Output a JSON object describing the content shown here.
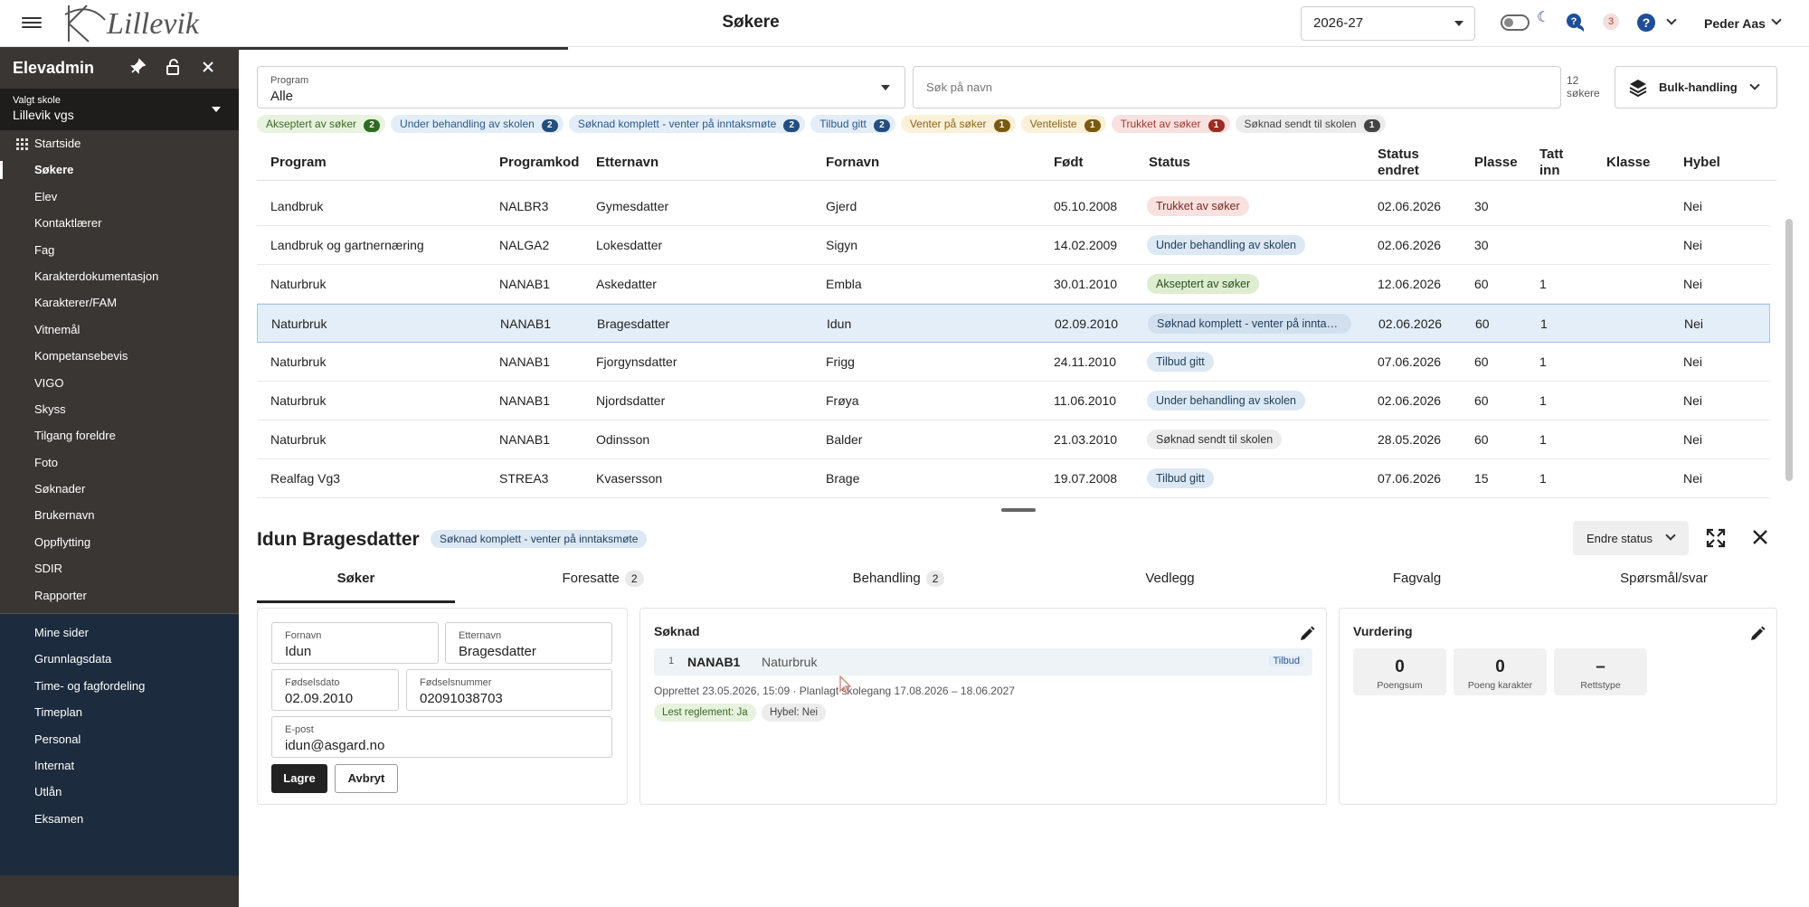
{
  "header": {
    "title": "Søkere",
    "logo_text": "Lillevik",
    "year": "2026-27",
    "notifications": "3",
    "user": "Peder Aas"
  },
  "sidebar": {
    "title": "Elevadmin",
    "school_label": "Valgt skole",
    "school_value": "Lillevik vgs",
    "items": [
      {
        "label": "Startside"
      },
      {
        "label": "Søkere"
      },
      {
        "label": "Elev"
      },
      {
        "label": "Kontaktlærer"
      },
      {
        "label": "Fag"
      },
      {
        "label": "Karakterdokumentasjon"
      },
      {
        "label": "Karakterer/FAM"
      },
      {
        "label": "Vitnemål"
      },
      {
        "label": "Kompetansebevis"
      },
      {
        "label": "VIGO"
      },
      {
        "label": "Skyss"
      },
      {
        "label": "Tilgang foreldre"
      },
      {
        "label": "Foto"
      },
      {
        "label": "Søknader"
      },
      {
        "label": "Brukernavn"
      },
      {
        "label": "Oppflytting"
      },
      {
        "label": "SDIR"
      },
      {
        "label": "Rapporter"
      }
    ],
    "secondary": [
      {
        "label": "Mine sider"
      },
      {
        "label": "Grunnlagsdata"
      },
      {
        "label": "Time- og fagfordeling"
      },
      {
        "label": "Timeplan"
      },
      {
        "label": "Personal"
      },
      {
        "label": "Internat"
      },
      {
        "label": "Utlån"
      },
      {
        "label": "Eksamen"
      }
    ]
  },
  "filters": {
    "program_label": "Program",
    "program_value": "Alle",
    "search_placeholder": "Søk på navn",
    "count_number": "12",
    "count_unit": "søkere",
    "bulk_label": "Bulk-handling"
  },
  "chips": [
    {
      "label": "Akseptert av søker",
      "count": "2"
    },
    {
      "label": "Under behandling av skolen",
      "count": "2"
    },
    {
      "label": "Søknad komplett - venter på inntaksmøte",
      "count": "2"
    },
    {
      "label": "Tilbud gitt",
      "count": "2"
    },
    {
      "label": "Venter på søker",
      "count": "1"
    },
    {
      "label": "Venteliste",
      "count": "1"
    },
    {
      "label": "Trukket av søker",
      "count": "1"
    },
    {
      "label": "Søknad sendt til skolen",
      "count": "1"
    }
  ],
  "table": {
    "headers": {
      "program": "Program",
      "code": "Programkod",
      "lastname": "Etternavn",
      "firstname": "Fornavn",
      "born": "Født",
      "status": "Status",
      "changed_1": "Status",
      "changed_2": "endret",
      "places": "Plasse",
      "taken_1": "Tatt",
      "taken_2": "inn",
      "class": "Klasse",
      "dorm": "Hybel"
    },
    "rows": [
      {
        "program": "Landbruk",
        "code": "NALBR3",
        "lastname": "Gymesdatter",
        "firstname": "Gjerd",
        "born": "05.10.2008",
        "status": "Trukket av søker",
        "changed": "02.06.2026",
        "places": "30",
        "taken": "",
        "class": "",
        "dorm": "Nei"
      },
      {
        "program": "Landbruk og gartnernæring",
        "code": "NALGA2",
        "lastname": "Lokesdatter",
        "firstname": "Sigyn",
        "born": "14.02.2009",
        "status": "Under behandling av skolen",
        "changed": "02.06.2026",
        "places": "30",
        "taken": "",
        "class": "",
        "dorm": "Nei"
      },
      {
        "program": "Naturbruk",
        "code": "NANAB1",
        "lastname": "Askedatter",
        "firstname": "Embla",
        "born": "30.01.2010",
        "status": "Akseptert av søker",
        "changed": "12.06.2026",
        "places": "60",
        "taken": "1",
        "class": "",
        "dorm": "Nei"
      },
      {
        "program": "Naturbruk",
        "code": "NANAB1",
        "lastname": "Bragesdatter",
        "firstname": "Idun",
        "born": "02.09.2010",
        "status": "Søknad komplett - venter på inntaksmøte",
        "changed": "02.06.2026",
        "places": "60",
        "taken": "1",
        "class": "",
        "dorm": "Nei"
      },
      {
        "program": "Naturbruk",
        "code": "NANAB1",
        "lastname": "Fjorgynsdatter",
        "firstname": "Frigg",
        "born": "24.11.2010",
        "status": "Tilbud gitt",
        "changed": "07.06.2026",
        "places": "60",
        "taken": "1",
        "class": "",
        "dorm": "Nei"
      },
      {
        "program": "Naturbruk",
        "code": "NANAB1",
        "lastname": "Njordsdatter",
        "firstname": "Frøya",
        "born": "11.06.2010",
        "status": "Under behandling av skolen",
        "changed": "02.06.2026",
        "places": "60",
        "taken": "1",
        "class": "",
        "dorm": "Nei"
      },
      {
        "program": "Naturbruk",
        "code": "NANAB1",
        "lastname": "Odinsson",
        "firstname": "Balder",
        "born": "21.03.2010",
        "status": "Søknad sendt til skolen",
        "changed": "28.05.2026",
        "places": "60",
        "taken": "1",
        "class": "",
        "dorm": "Nei"
      },
      {
        "program": "Realfag Vg3",
        "code": "STREA3",
        "lastname": "Kvasersson",
        "firstname": "Brage",
        "born": "19.07.2008",
        "status": "Tilbud gitt",
        "changed": "07.06.2026",
        "places": "15",
        "taken": "1",
        "class": "",
        "dorm": "Nei"
      }
    ]
  },
  "detail": {
    "name": "Idun Bragesdatter",
    "status": "Søknad komplett - venter på inntaksmøte",
    "change_status": "Endre status",
    "tabs": [
      {
        "label": "Søker",
        "count": ""
      },
      {
        "label": "Foresatte",
        "count": "2"
      },
      {
        "label": "Behandling",
        "count": "2"
      },
      {
        "label": "Vedlegg",
        "count": ""
      },
      {
        "label": "Fagvalg",
        "count": ""
      },
      {
        "label": "Spørsmål/svar",
        "count": ""
      }
    ],
    "form": {
      "firstname_label": "Fornavn",
      "firstname": "Idun",
      "lastname_label": "Etternavn",
      "lastname": "Bragesdatter",
      "dob_label": "Fødselsdato",
      "dob": "02.09.2010",
      "ssn_label": "Fødselsnummer",
      "ssn": "02091038703",
      "email_label": "E-post",
      "email": "idun@asgard.no",
      "save": "Lagre",
      "cancel": "Avbryt"
    },
    "application": {
      "title": "Søknad",
      "priority": "1",
      "code": "NANAB1",
      "program": "Naturbruk",
      "offer": "Tilbud",
      "meta": "Opprettet 23.05.2026, 15:09  ·  Planlagt skolegang 17.08.2026 – 18.06.2027",
      "tag_rules": "Lest reglement: Ja",
      "tag_dorm": "Hybel: Nei"
    },
    "assessment": {
      "title": "Vurdering",
      "scores": [
        {
          "value": "0",
          "label": "Poengsum"
        },
        {
          "value": "0",
          "label": "Poeng karakter"
        },
        {
          "value": "–",
          "label": "Rettstype"
        }
      ]
    }
  },
  "colors": {
    "sidebar": "#3a3634",
    "sidebar_secondary": "#1c2b3d",
    "accent": "#1f4e99",
    "selected_row": "#e4eef8"
  }
}
